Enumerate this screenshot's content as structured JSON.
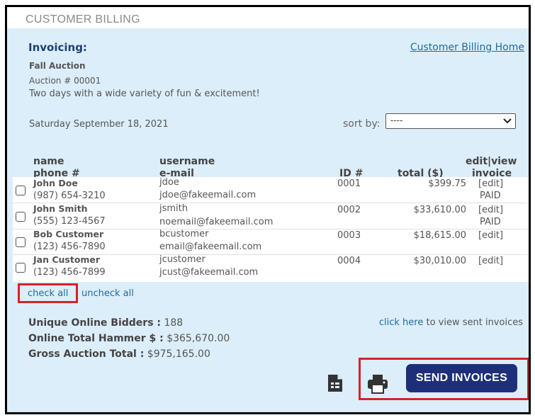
{
  "section_title": "CUSTOMER BILLING",
  "header": {
    "title": "Invoicing:",
    "home_link": "Customer Billing Home"
  },
  "auction": {
    "name": "Fall Auction",
    "number": "Auction # 00001",
    "description": "Two days with a wide variety of fun & excitement!",
    "date": "Saturday September 18, 2021"
  },
  "sort": {
    "label": "sort by:",
    "selected": "----"
  },
  "table": {
    "headers": {
      "name": "name",
      "phone": "phone #",
      "username": "username",
      "email": "e-mail",
      "id": "ID #",
      "total": "total ($)",
      "editview": "edit|view",
      "invoice": "invoice"
    },
    "rows": [
      {
        "name": "John Doe",
        "phone": "(987) 654-3210",
        "username": "jdoe",
        "email": "jdoe@fakeemail.com",
        "id": "0001",
        "total": "$399.75",
        "edit": "[edit]",
        "status": "PAID"
      },
      {
        "name": "John Smith",
        "phone": "(555) 123-4567",
        "username": "jsmith",
        "email": "noemail@fakeemail.com",
        "id": "0002",
        "total": "$33,610.00",
        "edit": "[edit]",
        "status": "PAID"
      },
      {
        "name": "Bob Customer",
        "phone": "(123) 456-7890",
        "username": "bcustomer",
        "email": "email@fakeemail.com",
        "id": "0003",
        "total": "$18,615.00",
        "edit": "[edit]",
        "status": ""
      },
      {
        "name": "Jan Customer",
        "phone": "(123) 456-7899",
        "username": "jcustomer",
        "email": "jcust@fakeemail.com",
        "id": "0004",
        "total": "$30,010.00",
        "edit": "[edit]",
        "status": ""
      }
    ]
  },
  "selection": {
    "check_all": "check all",
    "uncheck_all": "uncheck all"
  },
  "stats": {
    "unique_bidders_label": "Unique Online Bidders :",
    "unique_bidders_value": "188",
    "hammer_label": "Online Total Hammer $ :",
    "hammer_value": "$365,670.00",
    "gross_label": "Gross Auction Total :",
    "gross_value": "$975,165.00"
  },
  "sent_invoices": {
    "link": "click here",
    "text": "to view sent invoices"
  },
  "actions": {
    "send_label": "SEND INVOICES",
    "doc_icon": "document-icon",
    "print_icon": "printer-icon"
  },
  "colors": {
    "panel_bg": "#dceefa",
    "accent_blue": "#1e2f7a",
    "link": "#1f6c9b",
    "highlight_red": "#d6222a"
  }
}
